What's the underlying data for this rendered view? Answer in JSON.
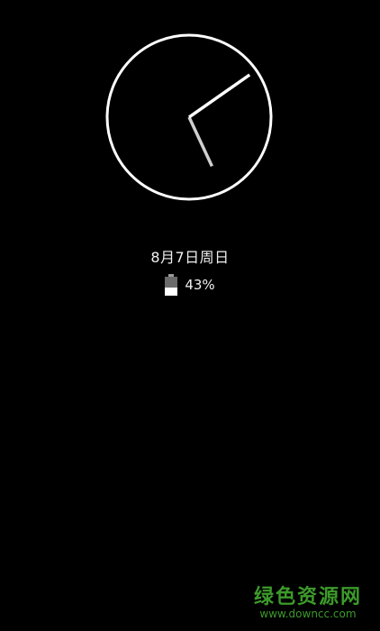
{
  "lockscreen": {
    "clock": {
      "hour_hand_angle_deg": 155,
      "minute_hand_angle_deg": 55,
      "colors": {
        "face": "#ffffff",
        "hour_hand": "#cfcfcf",
        "minute_hand": "#ffffff"
      }
    },
    "date": "8月7日周日",
    "battery": {
      "percent_label": "43%",
      "level": 0.43,
      "icon": "battery-icon"
    }
  },
  "watermark": {
    "title": "绿色资源网",
    "url": "www.downcc.com",
    "color": "#3c9a2a"
  }
}
